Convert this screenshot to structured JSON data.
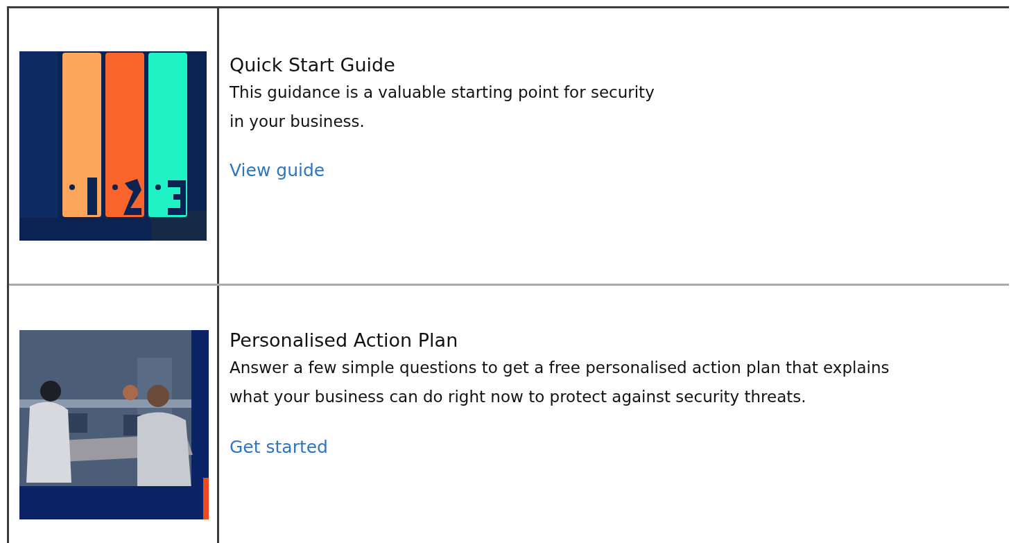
{
  "resources": [
    {
      "title": "Quick Start Guide",
      "description": "This guidance is a valuable starting point for security\nin your business.",
      "link": "View guide"
    },
    {
      "title": "Personalised Action Plan",
      "description": "Answer a few simple questions to get a free personalised action plan that explains what your business can do right now to protect against security threats.",
      "link": "Get started"
    }
  ]
}
